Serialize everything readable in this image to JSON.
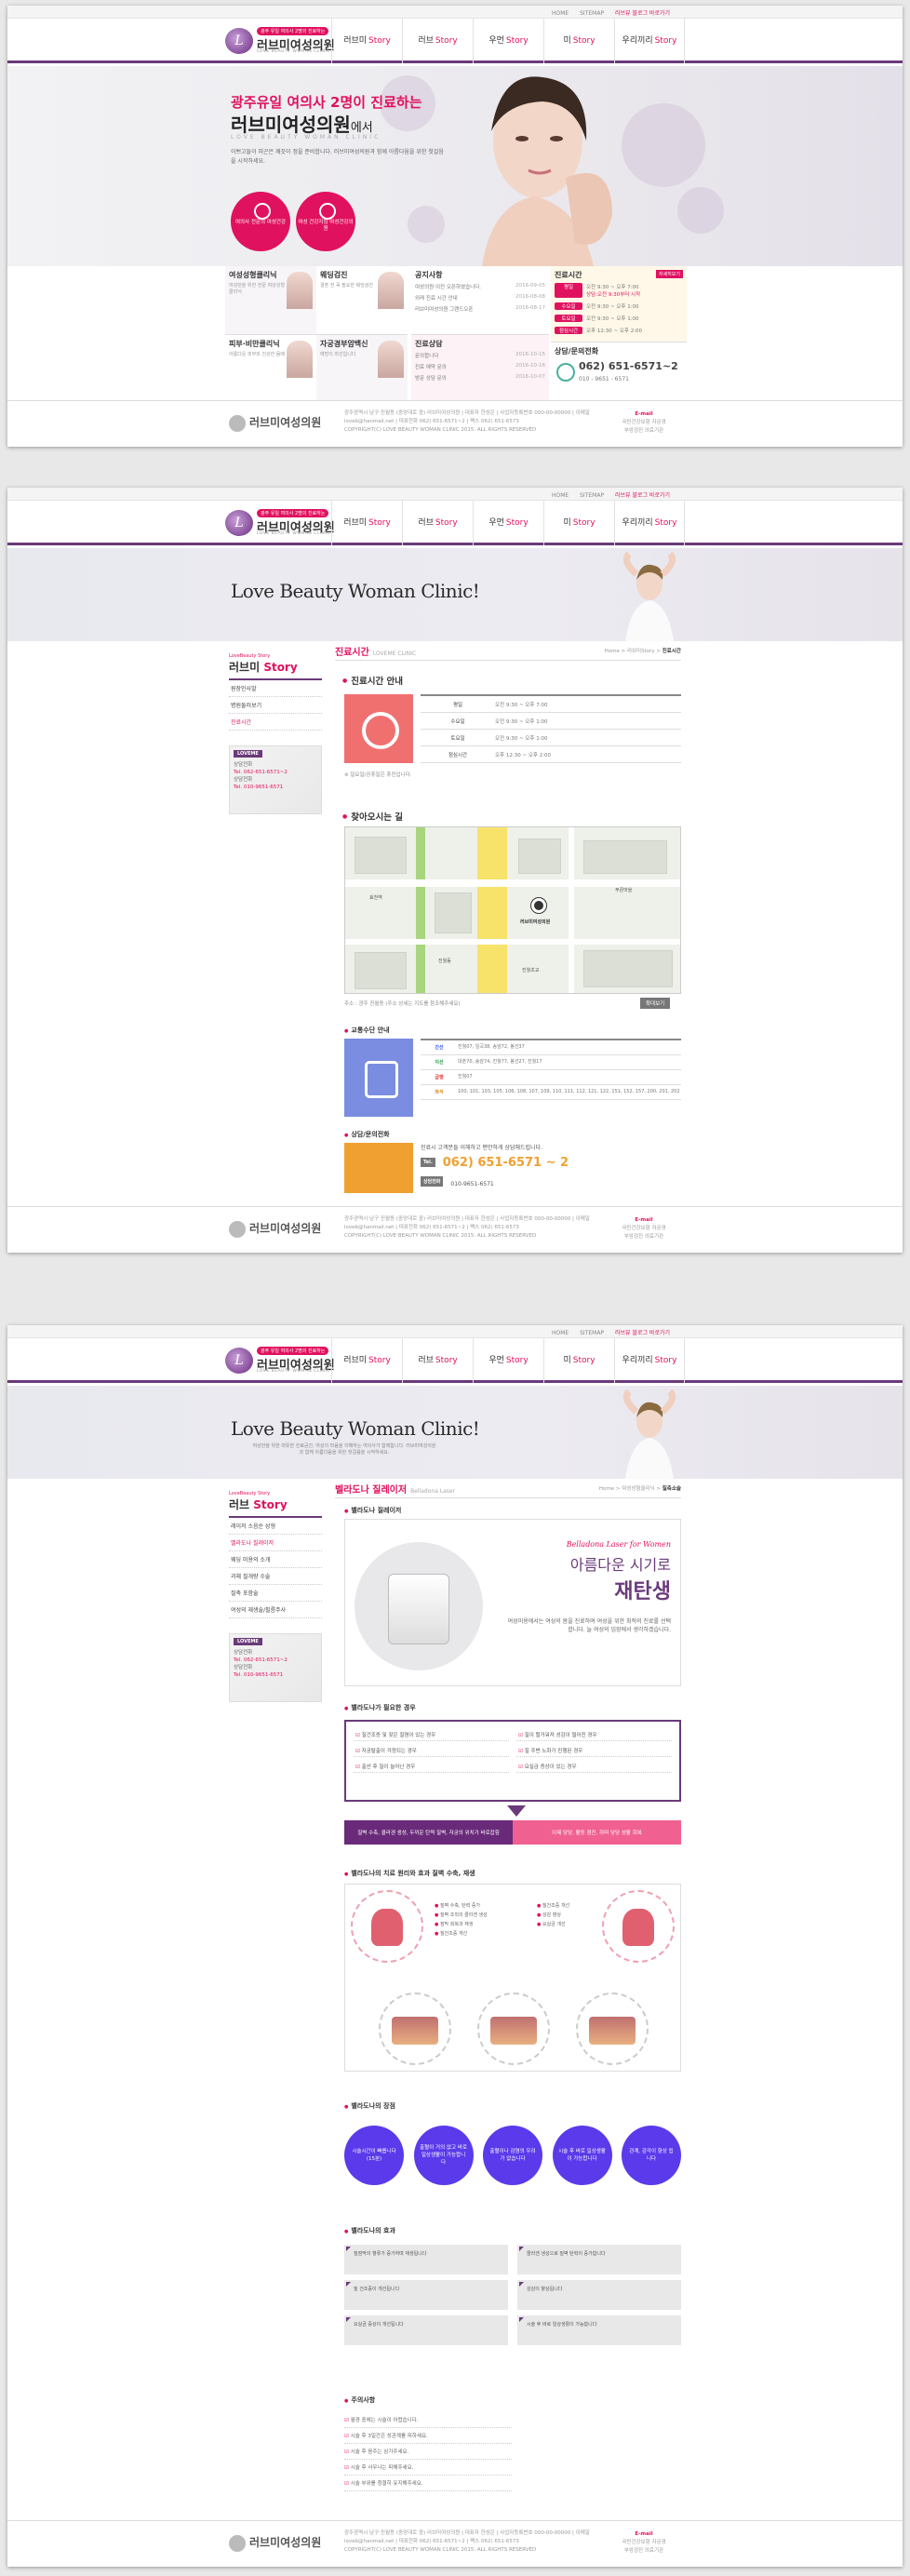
{
  "topbar": {
    "links": [
      "HOME",
      "SITEMAP",
      "러브뷰 블로그 바로가기"
    ]
  },
  "logo": {
    "tag": "광주 유일 여의사 2명의 진료하는",
    "name": "러브미여성의원",
    "en": "LOVE BEAUTY WOMAN CLINIC"
  },
  "nav": [
    {
      "k": "러브미",
      "e": "Story"
    },
    {
      "k": "러브",
      "e": "Story"
    },
    {
      "k": "우먼",
      "e": "Story"
    },
    {
      "k": "미",
      "e": "Story"
    },
    {
      "k": "우리끼리",
      "e": "Story"
    }
  ],
  "hero": {
    "sub": "광주유일 여의사 2명이 진료하는",
    "title": "러브미여성의원",
    "title_suffix": "에서",
    "en": "LOVE BEAUTY WOMAN CLINIC",
    "text": "이쁘고들이 피곤은 깨끗이 정을 준비합니다. 러브미여성의원과 함께 아름다움을 위한 첫걸음을 시작하세요.",
    "badges": [
      "여의사 전문의 여성건강",
      "여성 건강지킴 여성건강의원"
    ]
  },
  "quick": {
    "b1": {
      "title": "여성성형클리닉",
      "text": "여성만을 위한 전문 여성성형 클리닉"
    },
    "b2": {
      "title": "웨딩검진",
      "text": "결혼 전 꼭 필요한 웨딩검진"
    },
    "b3": {
      "title": "피부·비만클리닉",
      "text": "아름다운 피부와 건강한 몸매"
    },
    "b4": {
      "title": "자궁경부암백신",
      "text": "예방이 최선입니다"
    },
    "notice": {
      "title": "공지사항",
      "items": [
        [
          "여성의원 이전 오픈하였습니다.",
          "2016-09-05"
        ],
        [
          "외래 진료 시간 안내",
          "2016-08-08"
        ],
        [
          "러브미여성의원 그랜드오픈",
          "2016-08-17"
        ]
      ]
    },
    "consult": {
      "title": "진료상담",
      "items": [
        [
          "문의합니다",
          "2016-10-15"
        ],
        [
          "진료 예약 문의",
          "2016-10-16"
        ],
        [
          "방문 상담 문의",
          "2016-10-07"
        ]
      ]
    },
    "hours": {
      "title": "진료시간",
      "more": "자세히보기",
      "rows": [
        [
          "평일",
          "오전 9:30 ~ 오후 7:00",
          "상담:오전 9:30부터 시작"
        ],
        [
          "수요일",
          "오전 9:30 ~ 오후 1:00",
          ""
        ],
        [
          "토요일",
          "오전 9:30 ~ 오후 1:00",
          ""
        ],
        [
          "점심시간",
          "오후 12:30 ~ 오후 2:00",
          ""
        ]
      ],
      "note": "일요일/공휴일은 휴진입니다."
    },
    "phone": {
      "title": "상담/문의전화",
      "num": "062) 651-6571~2",
      "mobile": "010 - 9651 - 6571"
    }
  },
  "footer": {
    "name": "러브미여성의원",
    "addr": "광주광역시 남구 진월동 (중앙대로 중) 러브미여성의원 | 대표자 한성은 | 사업자등록번호 000-00-00000 | 이메일 loveb@hanmail.net | 대표전화 062) 651-6571~2 | 팩스 062) 651-6573",
    "copy": "COPYRIGHT(C) LOVE BEAUTY WOMAN CLINIC 2015. ALL RIGHTS RESERVED",
    "badge_top": "E-mail",
    "badge": "국민건강보험 자궁경부암검진 의료기관"
  },
  "sub": {
    "title": "Love Beauty Woman Clinic!",
    "text": "여성만을 위한 따뜻한 진료공간, 여성의 마음을 이해하는 여의사가 함께합니다. 러브미여성의원과 함께 아름다움을 위한 첫걸음을 시작하세요."
  },
  "p2": {
    "side": {
      "small": "LoveBeauty Story",
      "title1": "러브미",
      "title2": "Story",
      "items": [
        "원장인사말",
        "병원둘러보기",
        "진료시간"
      ],
      "cs_tag": "LOVEME",
      "cs": [
        "상담전화",
        "Tel. 062-651-6571~2",
        "상담전화",
        "Tel. 010-9651-6571"
      ]
    },
    "page": {
      "title": "진료시간",
      "en": "LOVEME CLINIC",
      "bc1": "Home",
      "bc2": "러브미Story",
      "bc3": "진료시간"
    },
    "hours_title": "진료시간 안내",
    "hours": [
      [
        "평일",
        "오전 9:30 ~ 오후 7:00"
      ],
      [
        "수요일",
        "오전 9:30 ~ 오후 1:00"
      ],
      [
        "토요일",
        "오전 9:30 ~ 오후 1:00"
      ],
      [
        "점심시간",
        "오후 12:30 ~ 오후 2:00"
      ]
    ],
    "hours_note": "※ 일요일/공휴일은 휴진입니다.",
    "map_title": "찾아오시는 길",
    "map_addr": "주소 : 광주 진월동 (주소 상세는 지도를 참조해주세요)",
    "map_btn": "확대보기",
    "map_labels": [
      "효천역",
      "진월동",
      "러브미여성의원",
      "진월초교",
      "푸른마을"
    ],
    "traffic_title": "교통수단 안내",
    "traffic": [
      [
        "간선",
        "진월07, 일곡38, 송암72, 봉선37"
      ],
      [
        "지선",
        "대촌70, 송암74, 진월77, 봉선27, 진월17"
      ],
      [
        "급행",
        "진월07"
      ],
      [
        "좌석",
        "100, 101, 103, 105, 106, 108, 107, 109, 110, 111, 112, 121, 122, 151, 152, 157, 200, 201, 202"
      ]
    ],
    "tel_title": "상담/문의전화",
    "tel_text": "진료시 고객분들 이해하고 편안하게 상담해드립니다.",
    "tel_tag": "Tel.",
    "tel_num": "062) 651-6571 ~ 2",
    "mob_tag": "상담전화",
    "mob": "010-9651-6571"
  },
  "p3": {
    "side": {
      "small": "LoveBeauty Story",
      "title1": "러브",
      "title2": "Story",
      "items": [
        "레이저 소음순 성형",
        "벨라도나 질레이저",
        "웨딩 미용의 소개",
        "과체 질개량 수술",
        "질축 포함술",
        "여성의 재생술/필름주사"
      ]
    },
    "page": {
      "title": "벨라도나 질레이저",
      "en": "Belladona Laser",
      "bc1": "Home",
      "bc2": "여성성형클리닉",
      "bc3": "질축소술"
    },
    "intro_title": "벨라도나 질레이저",
    "quote_en": "Belladona Laser for Women",
    "quote1": "아름다운 시기로",
    "quote2": "재탄생",
    "quote_p": "여성미용에서는 여성의 몸을 진료하며 여성을 위한 최적의 진료를 선택합니다. 늘 여성의 입장에서 생각하겠습니다.",
    "need_title": "벨라도나가 필요한 경우",
    "need": [
      "질건조증 및 잦은 질염이 있는 경우",
      "질이 헐거워져 성감이 떨어진 경우",
      "자궁탈출이 걱정되는 경우",
      "질 주변 노화가 진행된 경우",
      "출산 후 질이 늘어난 경우",
      "요실금 증상이 있는 경우"
    ],
    "bar_left": "질벽 수축, 콜라겐 생성, 두꺼운 탄력 질벽, 자궁의 위치가 바로잡힘",
    "bar_right": "이제 당당, 활동 점진, 하며 당당 성활 회복",
    "diag_title": "벨라도나의 치료 원리와 효과 질벽 수축, 재생",
    "diag_labels": [
      "질벽 수축, 탄력 증가",
      "질벽 조직의 콜라겐 생성",
      "점막 회복과 재생",
      "질건조증 개선",
      "성감 향상",
      "요실금 개선"
    ],
    "merit_title": "벨라도나의 장점",
    "merits": [
      "시술시간이 빠릅니다 (15분)",
      "출혈이 거의 없고 바로 일상생활이 가능합니다",
      "출혈이나 감염의 우려가 없습니다",
      "시술 후 바로 일상생활이 가능합니다",
      "관계, 감각이 향상 됩니다"
    ],
    "eff_title": "벨라도나의 효과",
    "effects": [
      "질점막의 혈류가 증가하며 재생됩니다",
      "콜라겐 생성으로 질벽 탄력이 증가합니다",
      "질 건조증이 개선됩니다",
      "성감이 향상됩니다",
      "요실금 증상이 개선됩니다",
      "시술 후 바로 일상생활이 가능합니다"
    ],
    "caut_title": "주의사항",
    "caution": [
      "월경 중에는 시술이 어렵습니다.",
      "시술 후 3일간은 성관계를 피하세요.",
      "시술 후 음주는 삼가주세요.",
      "시술 후 사우나는 피해주세요.",
      "시술 부위를 청결히 유지해주세요."
    ]
  }
}
